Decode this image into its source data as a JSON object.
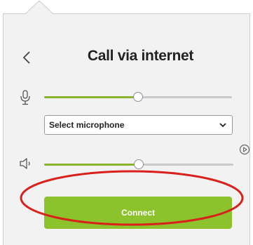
{
  "header": {
    "title": "Call via internet"
  },
  "microphone": {
    "level": 0.5,
    "select_value": "Select microphone"
  },
  "speaker": {
    "level": 0.5
  },
  "actions": {
    "connect_label": "Connect"
  },
  "colors": {
    "accent": "#8cc22b",
    "slider_fill": "#8db22f",
    "highlight": "#d9201a",
    "panel_bg": "#f2f2f2"
  },
  "icons": {
    "back": "chevron-left-icon",
    "mic": "microphone-icon",
    "speaker": "speaker-icon",
    "play": "play-circle-icon",
    "dropdown": "chevron-down-icon"
  }
}
